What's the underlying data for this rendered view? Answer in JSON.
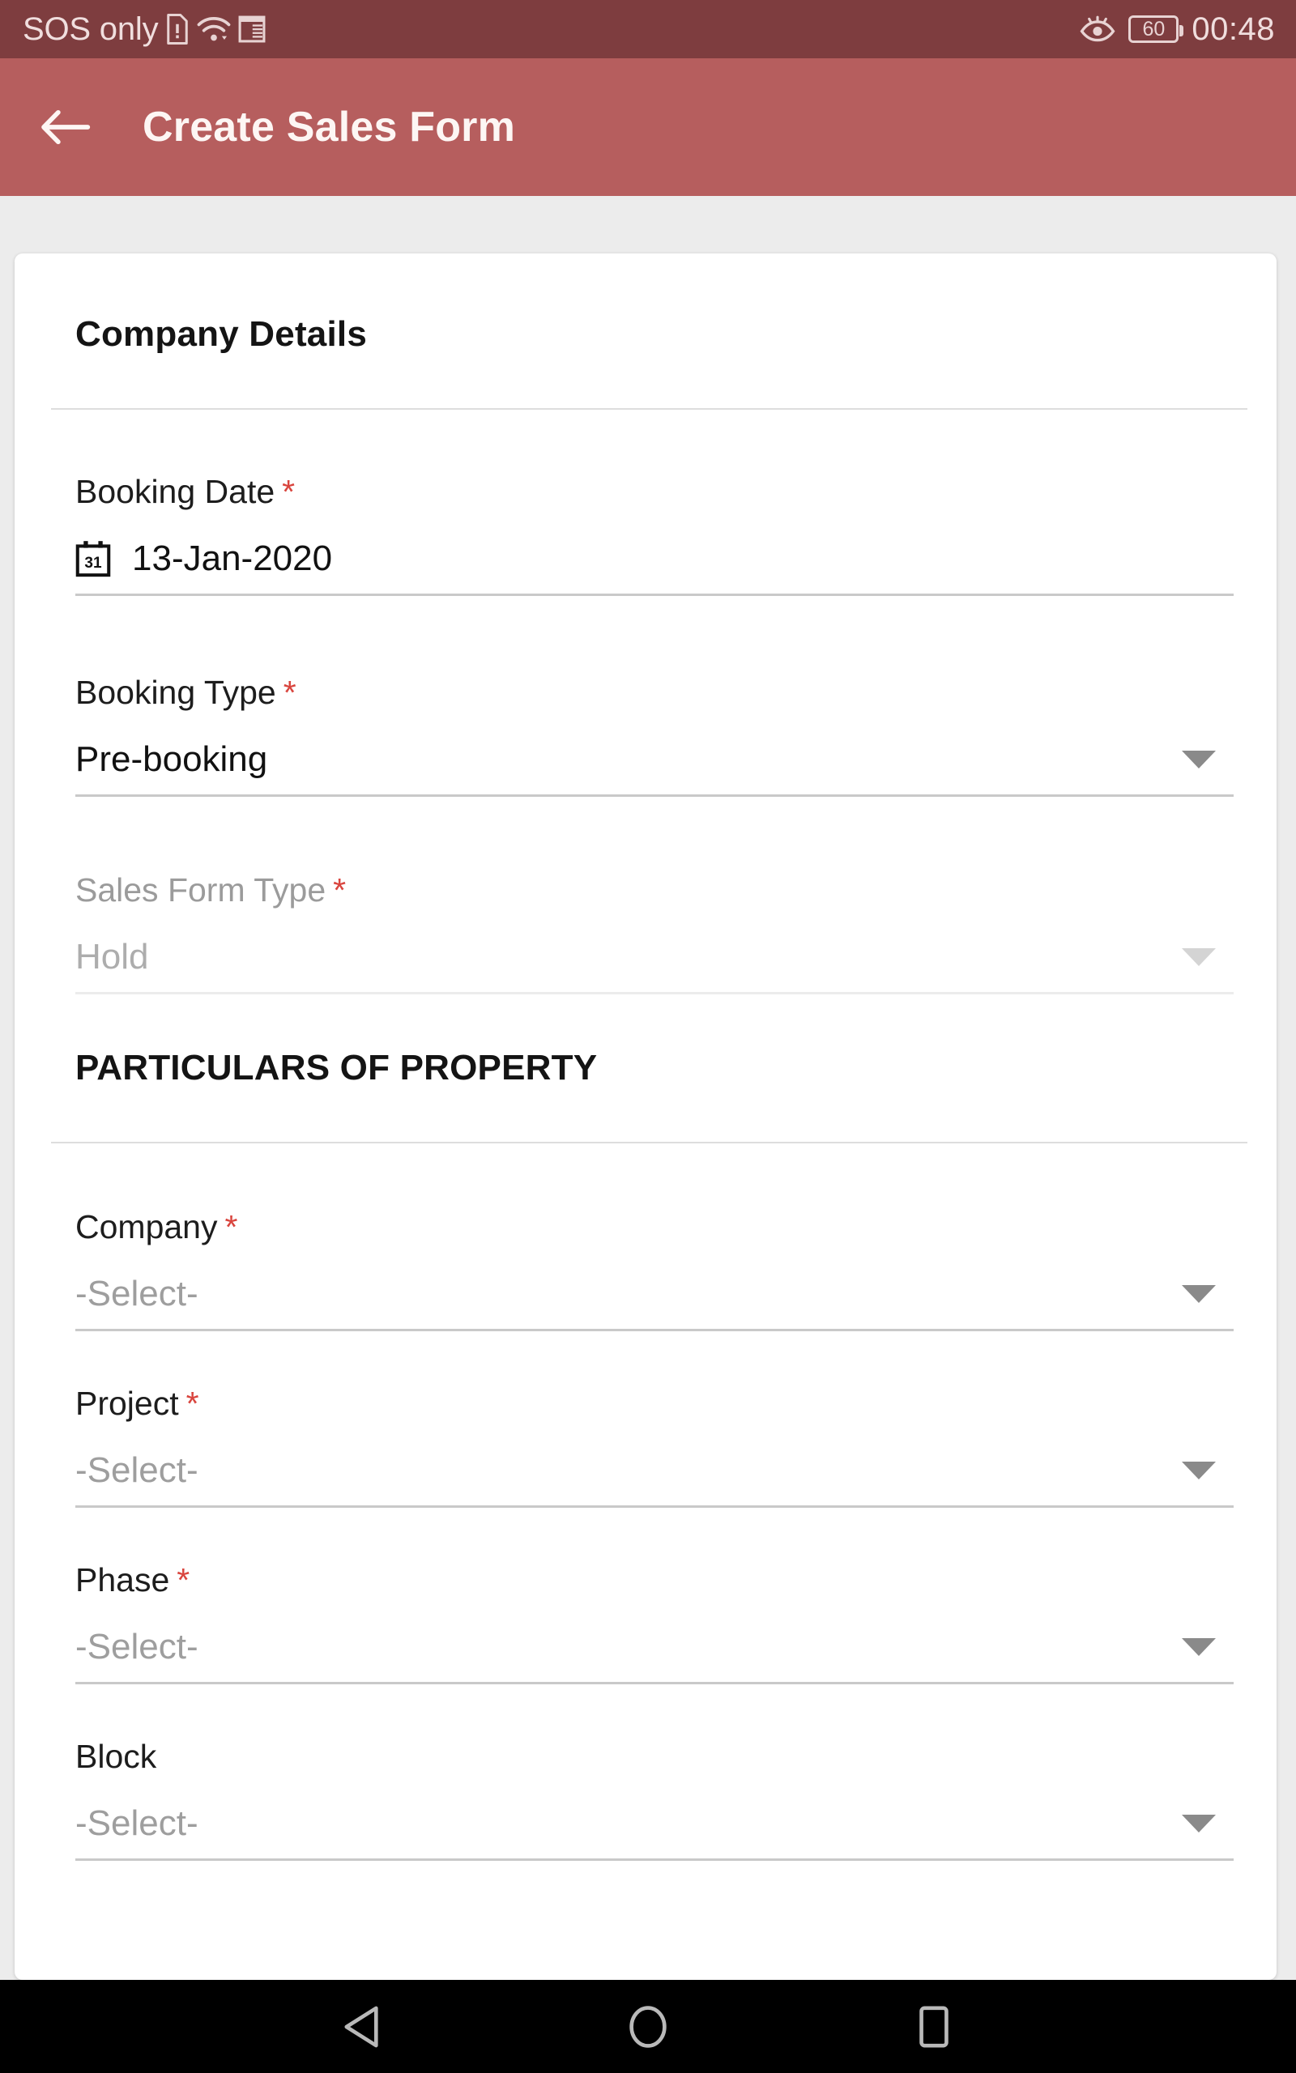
{
  "status_bar": {
    "carrier": "SOS only",
    "icons": [
      "sim-alert-icon",
      "wifi-icon",
      "sd-card-icon",
      "eye-comfort-icon"
    ],
    "battery_level": "60",
    "time": "00:48",
    "background_color": "#7e3d3f",
    "text_color": "#f0dede"
  },
  "app_bar": {
    "back_icon": "arrow-left-icon",
    "title": "Create Sales Form",
    "background_color": "#b65e5e",
    "title_color": "#fdf6f4"
  },
  "card": {
    "sections": [
      {
        "title": "Company Details",
        "style": "title-case"
      },
      {
        "title": "PARTICULARS OF PROPERTY",
        "style": "uppercase"
      }
    ]
  },
  "fields": {
    "booking_date": {
      "label": "Booking Date",
      "required": true,
      "required_marker": "*",
      "value": "13-Jan-2020",
      "icon": "calendar-icon",
      "calendar_day": "31",
      "type": "date",
      "disabled": false
    },
    "booking_type": {
      "label": "Booking Type",
      "required": true,
      "required_marker": "*",
      "value": "Pre-booking",
      "type": "dropdown",
      "disabled": false
    },
    "sales_form_type": {
      "label": "Sales Form Type",
      "required": true,
      "required_marker": "*",
      "value": "Hold",
      "type": "dropdown",
      "disabled": true
    },
    "company": {
      "label": "Company",
      "required": true,
      "required_marker": "*",
      "value": "-Select-",
      "type": "dropdown",
      "disabled": false,
      "is_placeholder": true
    },
    "project": {
      "label": "Project",
      "required": true,
      "required_marker": "*",
      "value": "-Select-",
      "type": "dropdown",
      "disabled": false,
      "is_placeholder": true
    },
    "phase": {
      "label": "Phase",
      "required": true,
      "required_marker": "*",
      "value": "-Select-",
      "type": "dropdown",
      "disabled": false,
      "is_placeholder": true
    },
    "block": {
      "label": "Block",
      "required": false,
      "required_marker": "",
      "value": "-Select-",
      "type": "dropdown",
      "disabled": false,
      "is_placeholder": true
    }
  },
  "nav_bar": {
    "back": "back-triangle-icon",
    "home": "home-circle-icon",
    "recents": "recents-square-icon",
    "background_color": "#000000"
  },
  "colors": {
    "required_asterisk": "#d9453e",
    "page_background": "#ececec",
    "card_background": "#ffffff",
    "underline": "#c9c9c9",
    "placeholder_text": "#9e9e9e"
  }
}
